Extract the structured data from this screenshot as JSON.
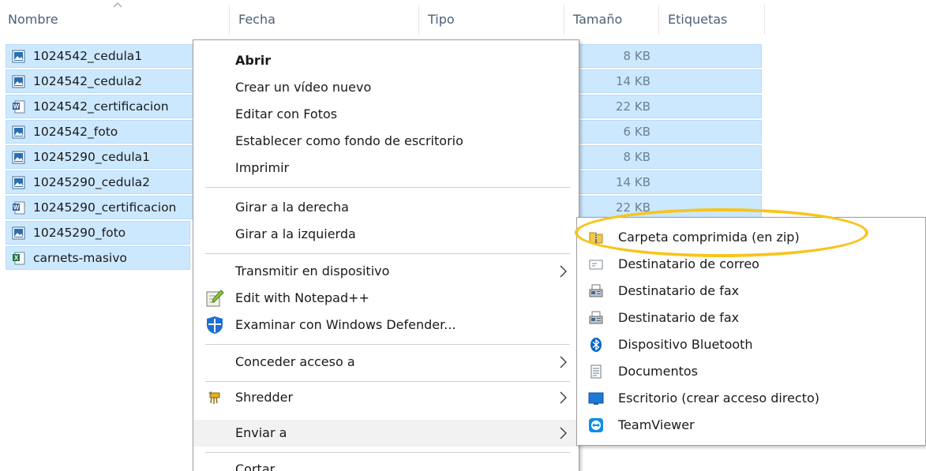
{
  "columns": {
    "name": "Nombre",
    "date": "Fecha",
    "type": "Tipo",
    "size": "Tamaño",
    "tags": "Etiquetas"
  },
  "files": [
    {
      "name": "1024542_cedula1",
      "size": "8 KB",
      "icon": "image-file-icon"
    },
    {
      "name": "1024542_cedula2",
      "size": "14 KB",
      "icon": "image-file-icon"
    },
    {
      "name": "1024542_certificacion",
      "size": "22 KB",
      "icon": "word-file-icon"
    },
    {
      "name": "1024542_foto",
      "size": "6 KB",
      "icon": "image-file-icon"
    },
    {
      "name": "10245290_cedula1",
      "size": "8 KB",
      "icon": "image-file-icon"
    },
    {
      "name": "10245290_cedula2",
      "size": "14 KB",
      "icon": "image-file-icon"
    },
    {
      "name": "10245290_certificacion",
      "size": "22 KB",
      "icon": "word-file-icon"
    },
    {
      "name": "10245290_foto",
      "size": "",
      "icon": "image-file-icon"
    },
    {
      "name": "carnets-masivo",
      "size": "",
      "icon": "excel-file-icon"
    }
  ],
  "context_menu": {
    "open": "Abrir",
    "create_video": "Crear un vídeo nuevo",
    "edit_photos": "Editar con Fotos",
    "set_wallpaper": "Establecer como fondo de escritorio",
    "print": "Imprimir",
    "rotate_right": "Girar a la derecha",
    "rotate_left": "Girar a la izquierda",
    "cast": "Transmitir en dispositivo",
    "notepad": "Edit with Notepad++",
    "defender": "Examinar con Windows Defender...",
    "give_access": "Conceder acceso a",
    "shredder": "Shredder",
    "send_to": "Enviar a",
    "cut": "Cortar"
  },
  "send_to_menu": {
    "zip": "Carpeta comprimida (en zip)",
    "mail": "Destinatario de correo",
    "fax1": "Destinatario de fax",
    "fax2": "Destinatario de fax",
    "bluetooth": "Dispositivo Bluetooth",
    "documents": "Documentos",
    "desktop": "Escritorio (crear acceso directo)",
    "teamviewer": "TeamViewer"
  },
  "colors": {
    "selection": "#cce8ff",
    "highlight_ring": "#f7c51c",
    "header_text": "#4c607a"
  }
}
